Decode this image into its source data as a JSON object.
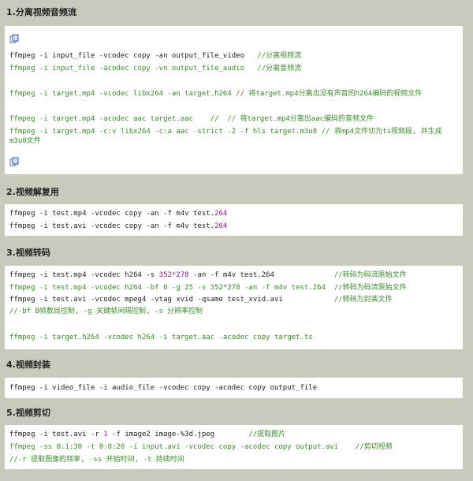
{
  "sections": [
    {
      "title": "1.分离视频音频流",
      "lines": [
        {
          "cmd": "ffmpeg -i input_file -vcodec copy -an output_file_video   ",
          "cmt": "//分离视频流"
        },
        {
          "cmd": "ffmpeg -i input_file -acodec copy -vn output_file_audio   ",
          "cmt": "//分离音频流"
        },
        {
          "cmd": "ffmpeg -i target.mp4 -vcodec libx264 -an target.h264    ",
          "cmt": "// 将target.mp4分离出没有声音的h264编码的视频文件"
        },
        {
          "cmd": "ffmpeg -i target.mp4 -acodec aac target.aac    ",
          "cmt": "//  // 将target.mp4分离出aac编码的音频文件"
        },
        {
          "cmd": "ffmpeg -i target.mp4 -c:v libx264 -c:a aac -strict -2 -f hls target.m3u8  ",
          "cmt": "// 将mp4文件切为ts视频段, 并生成m3u8文件"
        }
      ]
    },
    {
      "title": "2.视频解复用",
      "lines": [
        {
          "cmd": "ffmpeg -i test.mp4 -vcodec copy -an -f m4v test.",
          "num": "264"
        },
        {
          "cmd": "ffmpeg -i test.avi -vcodec copy -an -f m4v test.",
          "num": "264"
        }
      ]
    },
    {
      "title": "3.视频转码",
      "lines": [
        {
          "cmd": "ffmpeg -i test.mp4 -vcodec h264 -s ",
          "num": "352*278",
          "cmd2": " -an -f m4v test.264              ",
          "cmt": "//转码为码流原始文件"
        },
        {
          "cmd": "ffmpeg -i test.mp4 -vcodec h264 -bf 0 -g 25 -s 352*278 -an -f m4v test.264  ",
          "cmt": "//转码为码流原始文件"
        },
        {
          "cmd": "ffmpeg -i test.avi -vcodec mpeg4 -vtag xvid -qsame test_xvid.avi            ",
          "cmt": "//转码为封装文件"
        },
        {
          "cmt": "//-bf B帧数目控制, -g 关键帧间隔控制, -s 分辨率控制"
        },
        {
          "cmd": "ffmpeg -i target.h264 -vcodec h264 -i target.aac -acodec copy target.ts"
        }
      ]
    },
    {
      "title": "4.视频封装",
      "lines": [
        {
          "cmd": "ffmpeg -i video_file -i audio_file -vcodec copy -acodec copy output_file"
        }
      ]
    },
    {
      "title": "5.视频剪切",
      "lines": [
        {
          "cmd": "ffmpeg -i test.avi -r ",
          "num": "1",
          "cmd2": " -f image2 image-%3d.jpeg        ",
          "cmt": "//提取图片"
        },
        {
          "cmd": "ffmpeg -ss 0:1:30 -t 0:0:20 -i input.avi -vcodec copy -acodec copy output.avi    ",
          "cmt": "//剪切视频"
        },
        {
          "cmt": "//-r 提取图像的频率, -ss 开始时间, -t 持续时间"
        }
      ]
    }
  ]
}
